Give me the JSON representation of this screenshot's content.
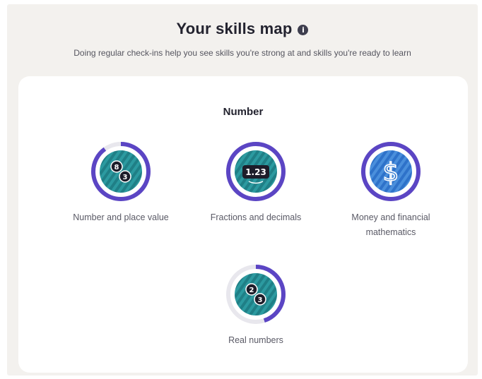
{
  "header": {
    "title": "Your skills map",
    "subtitle": "Doing regular check-ins help you see skills you're strong at and skills you're ready to learn",
    "info_icon": "info-icon"
  },
  "section": {
    "title": "Number"
  },
  "skills": [
    {
      "label": "Number and place value",
      "progress": 0.9,
      "icon": "number-place-value-icon",
      "badge_top": "8",
      "badge_bottom": "3"
    },
    {
      "label": "Fractions and decimals",
      "progress": 1.0,
      "icon": "fractions-decimals-icon",
      "badge_text": "1.23"
    },
    {
      "label": "Money and financial mathematics",
      "progress": 1.0,
      "icon": "dollar-icon",
      "badge_text": "$"
    },
    {
      "label": "Real numbers",
      "progress": 0.45,
      "icon": "real-numbers-icon",
      "badge_top": "2",
      "badge_bottom": "3"
    }
  ],
  "colors": {
    "ring_progress": "#5b45c4",
    "ring_track": "#e8e7ed",
    "teal_fill": "#1f7f86",
    "teal_stripe": "#2c9aa0",
    "blue_fill": "#2e72c9",
    "blue_stripe": "#4a8fdc"
  }
}
